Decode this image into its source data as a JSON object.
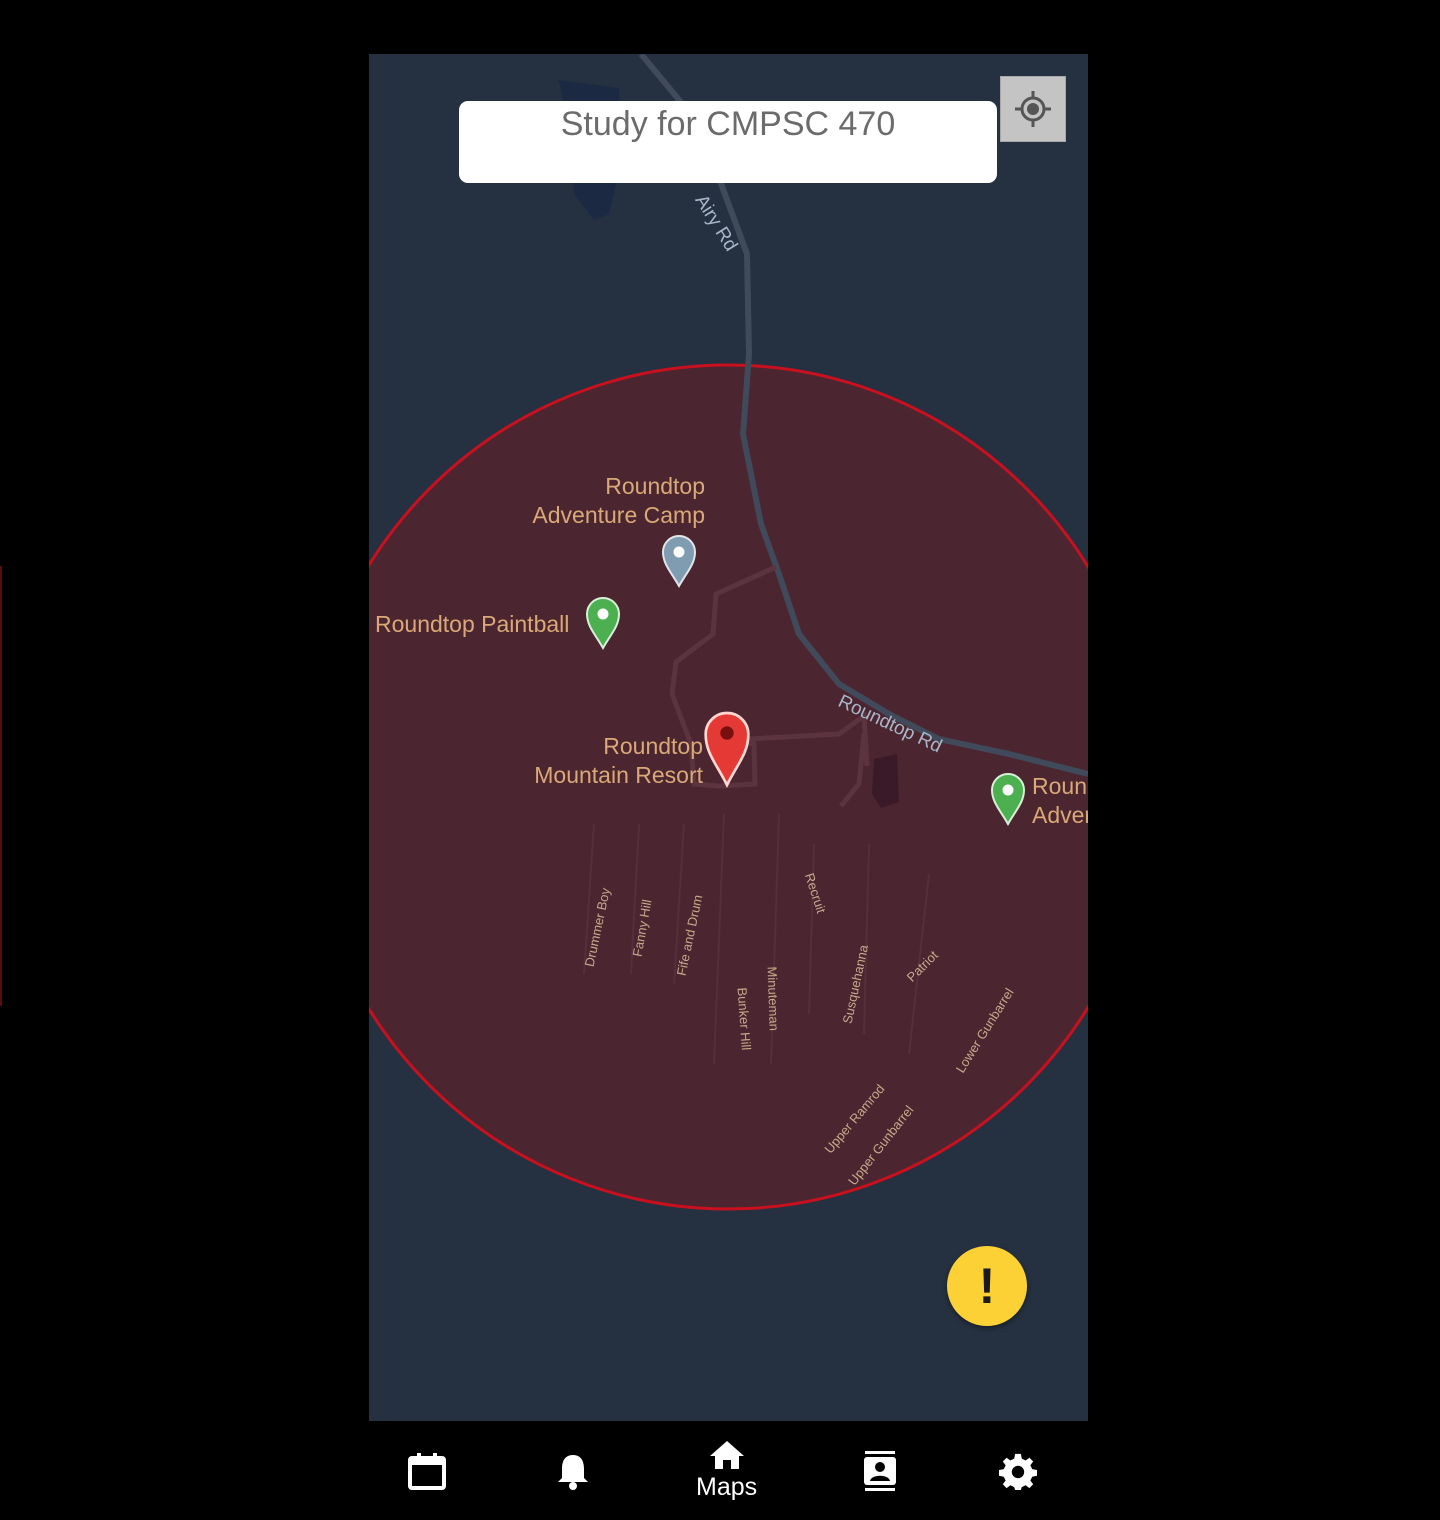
{
  "task_card": {
    "title": "Study for CMPSC 470"
  },
  "map": {
    "places": {
      "adventure_camp": [
        "Roundtop",
        "Adventure Camp"
      ],
      "paintball": "Roundtop Paintball",
      "mountain_resort": [
        "Roundtop",
        "Mountain Resort"
      ],
      "right_cut": [
        "Roun",
        "Adver"
      ]
    },
    "roads": {
      "airy": "Airy Rd",
      "roundtop": "Roundtop Rd"
    },
    "trails": [
      "Recruit",
      "Drummer Boy",
      "Fanny Hill",
      "Fife and Drum",
      "Minuteman",
      "Bunker Hill",
      "Susquehanna",
      "Patriot",
      "Lower Gunbarrel",
      "Upper Ramrod",
      "Upper Gunbarrel"
    ],
    "geofence_color": "#c8101e",
    "fab_color": "#fbd135"
  },
  "alert_button": {
    "label": "!"
  },
  "nav": {
    "items": [
      {
        "icon": "calendar-icon",
        "label": ""
      },
      {
        "icon": "bell-icon",
        "label": ""
      },
      {
        "icon": "home-icon",
        "label": "Maps"
      },
      {
        "icon": "contacts-icon",
        "label": ""
      },
      {
        "icon": "gear-icon",
        "label": ""
      }
    ]
  }
}
